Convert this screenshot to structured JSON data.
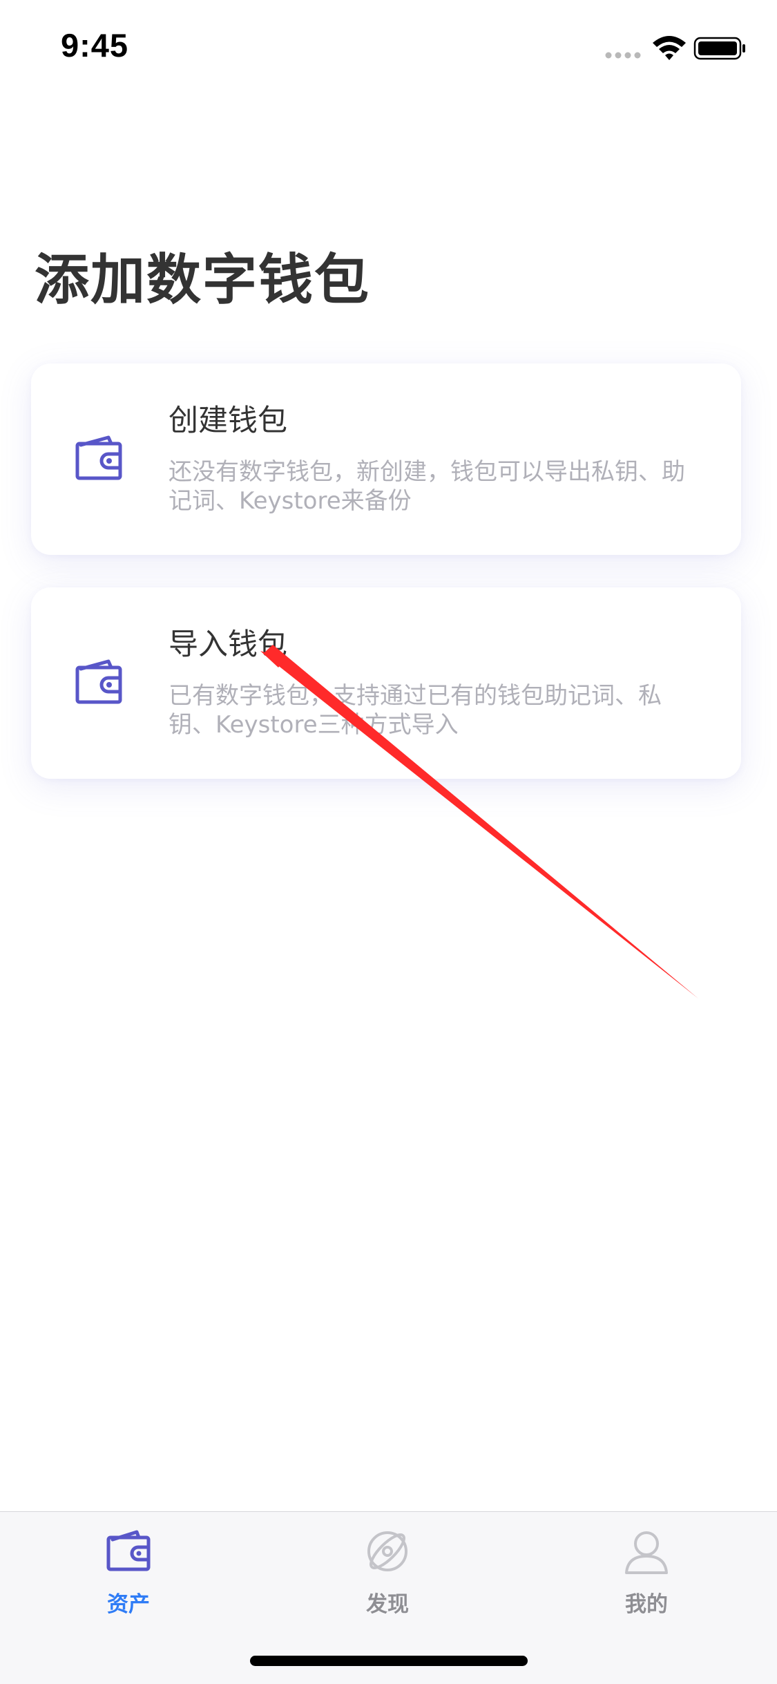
{
  "status_bar": {
    "time": "9:45",
    "icons": [
      "signal-dots-icon",
      "wifi-icon",
      "battery-icon"
    ]
  },
  "page": {
    "title": "添加数字钱包"
  },
  "cards": [
    {
      "id": "create",
      "icon": "wallet-icon",
      "title": "创建钱包",
      "description": "还没有数字钱包，新创建，钱包可以导出私钥、助记词、Keystore来备份"
    },
    {
      "id": "import",
      "icon": "wallet-icon",
      "title": "导入钱包",
      "description": "已有数字钱包，支持通过已有的钱包助记词、私钥、Keystore三种方式导入"
    }
  ],
  "annotation": {
    "type": "red-arrow",
    "color": "#ff2a2a",
    "target": "import-wallet-title"
  },
  "tab_bar": {
    "active": "assets",
    "items": [
      {
        "id": "assets",
        "label": "资产",
        "icon": "wallet-icon"
      },
      {
        "id": "discover",
        "label": "发现",
        "icon": "compass-icon"
      },
      {
        "id": "mine",
        "label": "我的",
        "icon": "user-icon"
      }
    ]
  },
  "colors": {
    "accent": "#2f7cf6",
    "icon_purple": "#5856c8",
    "title_text": "#333333",
    "desc_text": "#b0b0b8",
    "tab_inactive": "#8e8e93"
  }
}
